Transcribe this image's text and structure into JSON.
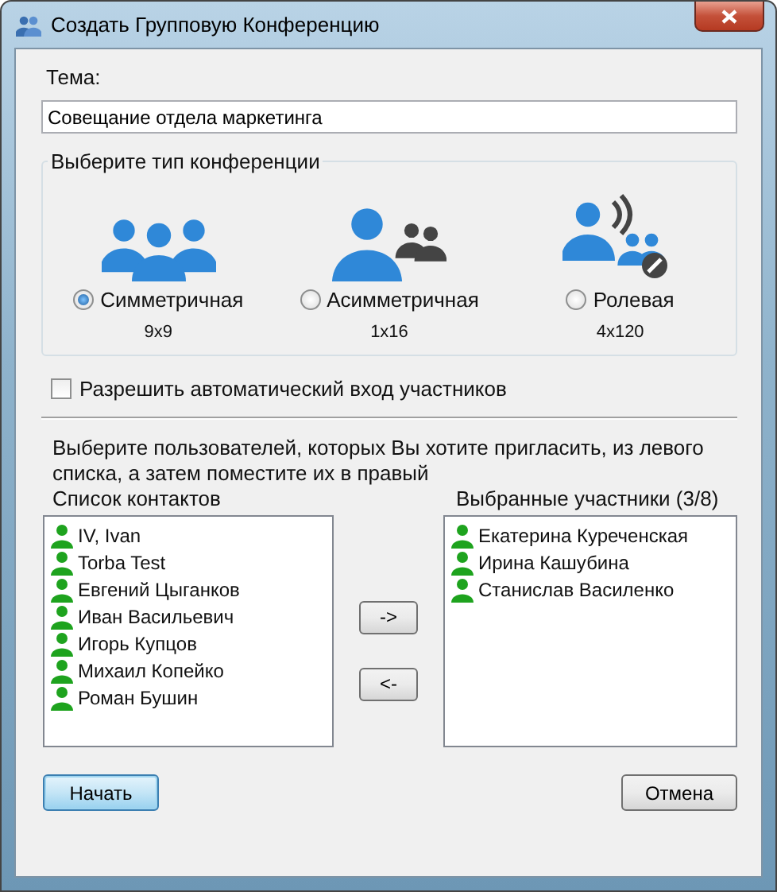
{
  "window": {
    "title": "Создать Групповую Конференцию"
  },
  "topic": {
    "label": "Тема:",
    "value": "Совещание отдела маркетинга"
  },
  "conference_type": {
    "title": "Выберите тип конференции",
    "options": [
      {
        "kind": "symmetric",
        "label": "Симметричная",
        "size": "9x9",
        "selected": true
      },
      {
        "kind": "asymmetric",
        "label": "Асимметричная",
        "size": "1x16",
        "selected": false
      },
      {
        "kind": "role",
        "label": "Ролевая",
        "size": "4x120",
        "selected": false
      }
    ]
  },
  "auto_join": {
    "label": "Разрешить автоматический вход участников",
    "checked": false
  },
  "instructions": "Выберите пользователей, которых Вы хотите пригласить, из левого списка, а затем поместите их в правый",
  "contacts": {
    "title": "Список контактов",
    "items": [
      "IV, Ivan",
      "Torba Test",
      "Евгений Цыганков",
      "Иван Васильевич",
      "Игорь Купцов",
      "Михаил Копейко",
      "Роман Бушин"
    ]
  },
  "move_buttons": [
    "->",
    "<-"
  ],
  "participants": {
    "title": "Выбранные участники (3/8)",
    "items": [
      "Екатерина Куреченская",
      "Ирина Кашубина",
      "Станислав Василенко"
    ]
  },
  "buttons": {
    "start": "Начать",
    "cancel": "Отмена"
  }
}
